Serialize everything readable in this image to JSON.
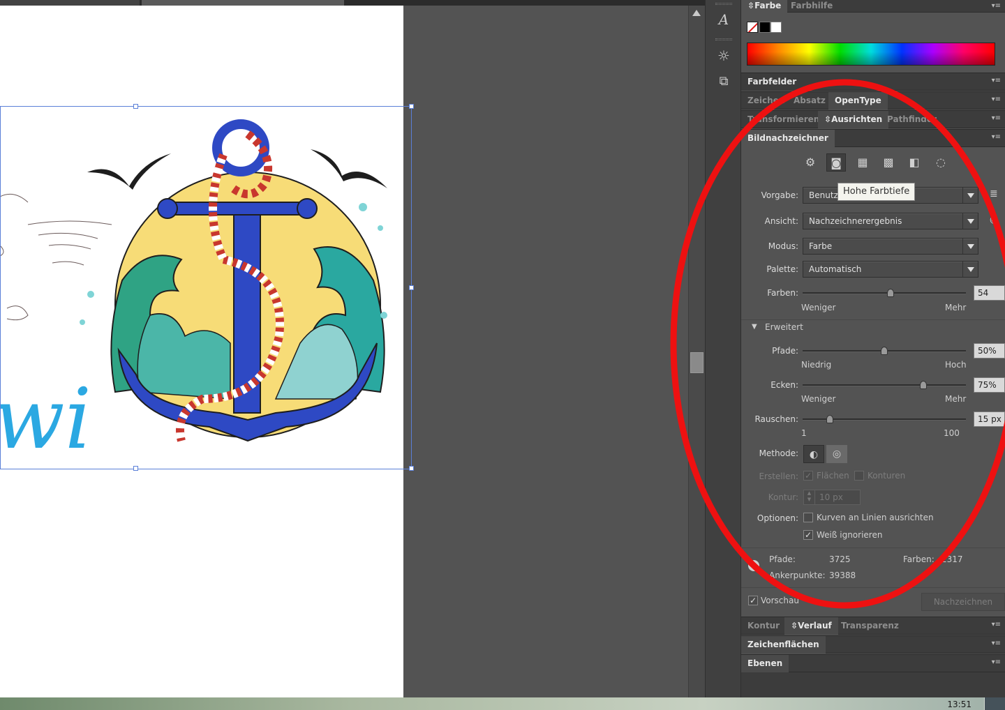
{
  "panels": {
    "color": {
      "tabs": [
        "Farbe",
        "Farbhilfe"
      ]
    },
    "swatches": {
      "title": "Farbfelder"
    },
    "type": {
      "tabs": [
        "Zeichen",
        "Absatz",
        "OpenType"
      ]
    },
    "align": {
      "tabs": [
        "Transformieren",
        "Ausrichten",
        "Pathfinder"
      ]
    },
    "bottom": {
      "tabs": [
        "Kontur",
        "Verlauf",
        "Transparenz"
      ]
    },
    "artboards": {
      "title": "Zeichenflächen"
    },
    "layers": {
      "title": "Ebenen"
    }
  },
  "trace": {
    "title": "Bildnachzeichner",
    "preset_icons": [
      "auto-color-icon",
      "high-color-camera-icon",
      "low-color-grid-icon",
      "grayscale-icon",
      "black-white-icon",
      "outline-icon"
    ],
    "tooltip": "Hohe Farbtiefe",
    "vorgabe": {
      "label": "Vorgabe:",
      "value": "Benutzerdefiniert"
    },
    "ansicht": {
      "label": "Ansicht:",
      "value": "Nachzeichnerergebnis"
    },
    "modus": {
      "label": "Modus:",
      "value": "Farbe"
    },
    "palette": {
      "label": "Palette:",
      "value": "Automatisch"
    },
    "farben": {
      "label": "Farben:",
      "value": "54",
      "min_label": "Weniger",
      "max_label": "Mehr",
      "level": 0.54
    },
    "erweitert": {
      "label": "Erweitert"
    },
    "pfade": {
      "label": "Pfade:",
      "value": "50%",
      "min_label": "Niedrig",
      "max_label": "Hoch",
      "level": 0.5
    },
    "ecken": {
      "label": "Ecken:",
      "value": "75%",
      "min_label": "Weniger",
      "max_label": "Mehr",
      "level": 0.75
    },
    "rauschen": {
      "label": "Rauschen:",
      "value": "15 px",
      "min_label": "1",
      "max_label": "100",
      "level": 0.15
    },
    "methode": {
      "label": "Methode:"
    },
    "erstellen": {
      "label": "Erstellen:",
      "flaechen": "Flächen",
      "konturen": "Konturen"
    },
    "kontur": {
      "label": "Kontur:",
      "value": "10 px"
    },
    "optionen": {
      "label": "Optionen:",
      "opt1": "Kurven an Linien ausrichten",
      "opt2": "Weiß ignorieren"
    },
    "stats": {
      "pfade_label": "Pfade:",
      "pfade_value": "3725",
      "farben_label": "Farben:",
      "farben_value": "2317",
      "anker_label": "Ankerpunkte:",
      "anker_value": "39388"
    },
    "vorschau": "Vorschau",
    "nachzeichnen": "Nachzeichnen"
  },
  "artwork": {
    "lettering": "wi"
  },
  "taskbar": {
    "clock": "13:51"
  },
  "colors": {
    "annotation": "#ee1111",
    "selection": "#5a7fd8",
    "panel_bg": "#535353"
  }
}
